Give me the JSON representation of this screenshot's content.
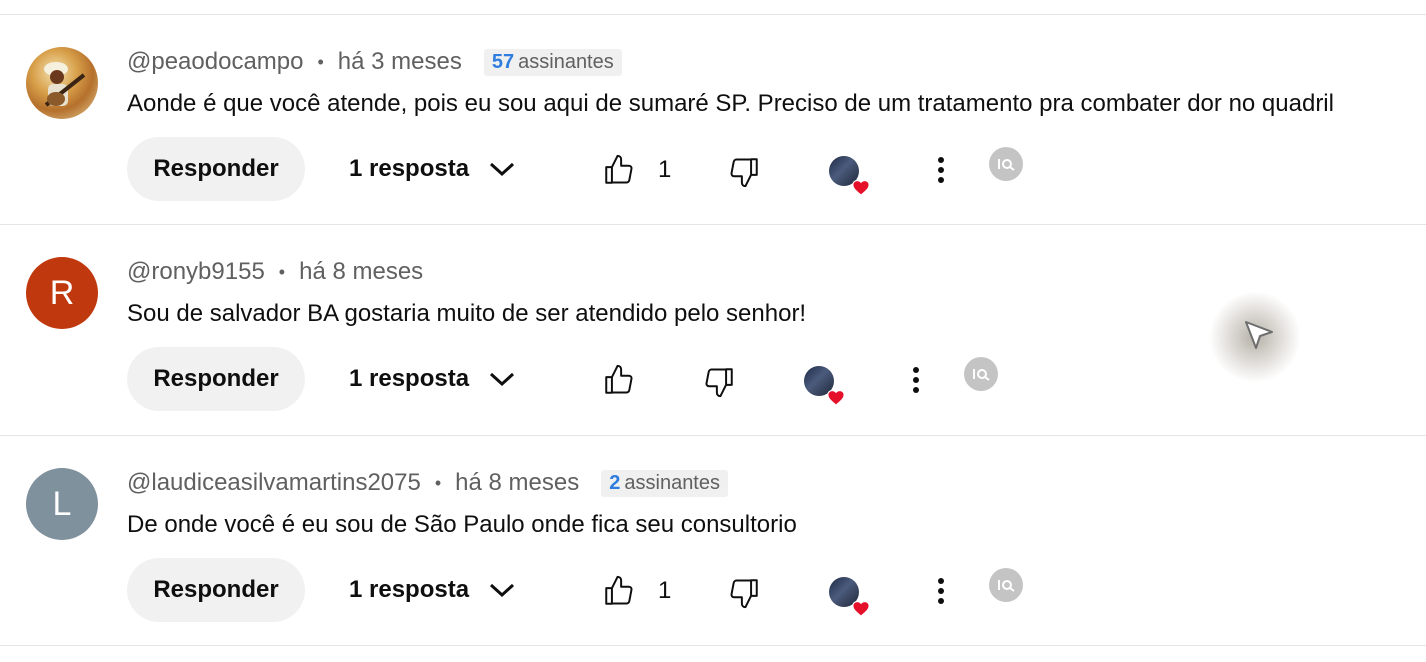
{
  "comments": [
    {
      "author": "@peaodocampo",
      "time": "há 3 meses",
      "subscribers_count": "57",
      "subscribers_label": "assinantes",
      "text": "Aonde é que você atende, pois eu sou aqui de sumaré SP. Preciso de um tratamento pra combater dor no quadril",
      "reply_label": "Responder",
      "replies_label": "1 resposta",
      "like_count": "1",
      "avatar_type": "photo"
    },
    {
      "author": "@ronyb9155",
      "time": "há 8 meses",
      "avatar_letter": "R",
      "avatar_color": "#c0380d",
      "text": "Sou de salvador BA gostaria muito de ser atendido pelo senhor!",
      "reply_label": "Responder",
      "replies_label": "1 resposta"
    },
    {
      "author": "@laudiceasilvamartins2075",
      "time": "há 8 meses",
      "subscribers_count": "2",
      "subscribers_label": "assinantes",
      "avatar_letter": "L",
      "avatar_color": "#7e919d",
      "text": "De onde você  é  eu sou de São Paulo  onde fica seu consultorio",
      "reply_label": "Responder",
      "replies_label": "1 resposta",
      "like_count": "1"
    }
  ],
  "icons": {
    "like": "thumb-up-icon",
    "dislike": "thumb-down-icon",
    "hearted": "creator-heart-icon",
    "more": "more-vert-icon",
    "extension": "extension-icon",
    "expand": "chevron-down-icon"
  },
  "colors": {
    "heart": "#e5112b",
    "badge_number": "#2f7ddf"
  }
}
